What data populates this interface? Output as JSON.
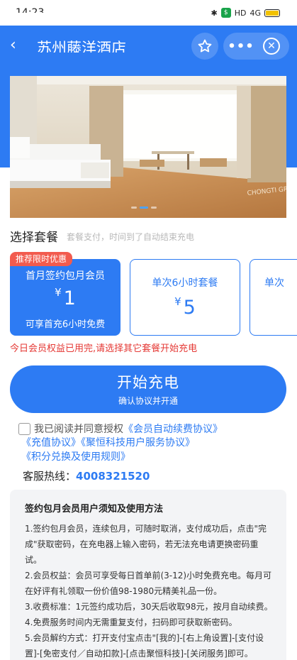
{
  "status_bar": {
    "time": "14:23",
    "hd": "HD",
    "signal": "4G"
  },
  "nav": {
    "back_icon": "‹",
    "title": "苏州藤洋酒店",
    "more_icon": "•••",
    "close_icon": "✕"
  },
  "banner": {
    "image": "hotel-room-photo",
    "slide_count": 3,
    "active_slide": 1
  },
  "section": {
    "title": "选择套餐",
    "subtitle": "套餐支付，时间到了自动结束充电"
  },
  "promo_tag": "推荐限时优惠",
  "packages": [
    {
      "name": "首月签约包月会员",
      "currency": "¥",
      "price": "1",
      "note": "可享首充6小时免费"
    },
    {
      "name": "单次6小时套餐",
      "currency": "¥",
      "price": "5"
    },
    {
      "name": "单次"
    }
  ],
  "warning": "今日会员权益已用完,请选择其它套餐开始充电",
  "cta": {
    "main": "开始充电",
    "sub": "确认协议并开通"
  },
  "agreement": {
    "prefix": "我已阅读并同意授权",
    "link1": "《会员自动续费协议》",
    "link2": "《充值协议》《聚恒科技用户服务协议》",
    "link3": "《积分兑换及使用规则》"
  },
  "hotline": {
    "label": "客服热线：",
    "number": "4008321520"
  },
  "notice": {
    "title": "签约包月会员用户须知及使用方法",
    "items": [
      "1.签约包月会员，连续包月，可随时取消，支付成功后，点击\"完成\"获取密码，在充电器上输入密码，若无法充电请更换密码重试。",
      "2.会员权益：会员可享受每日首单前(3-12)小时免费充电。每月可在好评有礼领取一份价值98-1980元精美礼品一份。",
      "3.收费标准：1元签约成功后，30天后收取98元，按月自动续费。",
      "4.免费服务时间内无需重复支付，扫码即可获取新密码。",
      "5.会员解约方式：打开支付宝点击\"[我的]-[右上角设置]-[支付设置]-[免密支付／自动扣款]-[点击聚恒科技]-[关闭服务]即可。"
    ]
  },
  "colors": {
    "primary": "#2d7bf3",
    "warning": "#e53935",
    "promo": "#f25b4e"
  }
}
